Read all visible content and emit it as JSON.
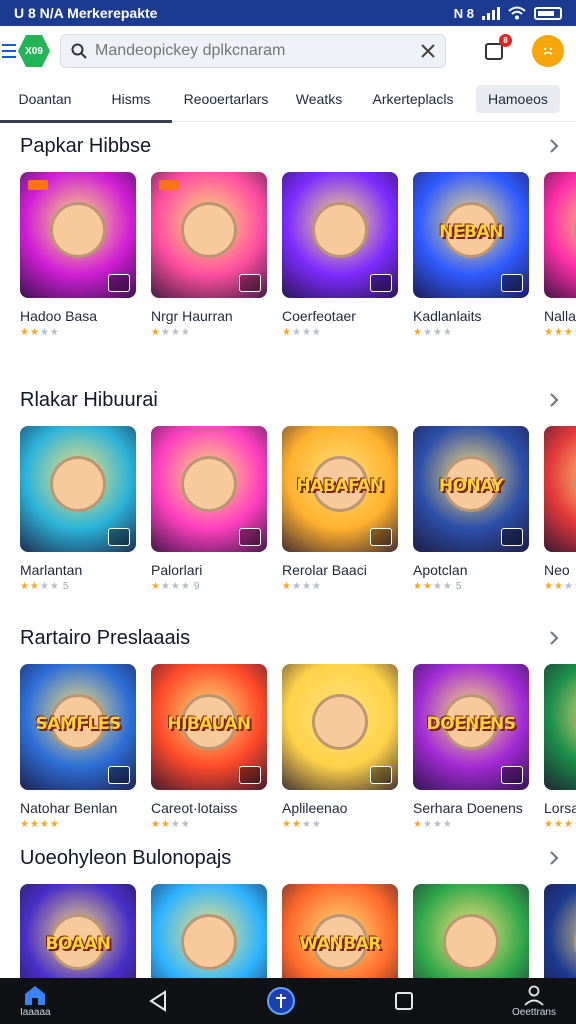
{
  "status_bar": {
    "left_text": "U 8 N/A Merkerepakte",
    "right_text": "N 8"
  },
  "search": {
    "placeholder": "Mandeopickey dplkcnaram"
  },
  "top_bar": {
    "logo_text": "X09",
    "notification_count": "8"
  },
  "tabs": [
    "Doantan",
    "Hisms",
    "Reooertarlars",
    "Weatks",
    "Arkerteplacls",
    "Hamoeos"
  ],
  "sections": [
    {
      "title": "Papkar Hibbse",
      "items": [
        {
          "name": "Hadoo Basa",
          "stars": 2,
          "count": ""
        },
        {
          "name": "Nrgr Haurran",
          "stars": 1,
          "count": ""
        },
        {
          "name": "Coerfeotaer",
          "stars": 1,
          "count": ""
        },
        {
          "name": "Kadlanlaits",
          "stars": 1,
          "count": ""
        },
        {
          "name": "Nalla",
          "stars": 3,
          "count": ""
        }
      ]
    },
    {
      "title": "Rlakar Hibuurai",
      "items": [
        {
          "name": "Marlantan",
          "stars": 2,
          "count": "5"
        },
        {
          "name": "Palorlari",
          "stars": 1,
          "count": "9"
        },
        {
          "name": "Rerolar Baaci",
          "stars": 1,
          "count": ""
        },
        {
          "name": "Apotclan",
          "stars": 2,
          "count": "5"
        },
        {
          "name": "Neo",
          "stars": 2,
          "count": ""
        }
      ]
    },
    {
      "title": "Rartairo Preslaaais",
      "items": [
        {
          "name": "Natohar Benlan",
          "stars": 4,
          "count": ""
        },
        {
          "name": "Careot·lotaiss",
          "stars": 2,
          "count": ""
        },
        {
          "name": "Aplileenao",
          "stars": 2,
          "count": ""
        },
        {
          "name": "Serhara Doenens",
          "stars": 1,
          "count": ""
        },
        {
          "name": "Lorsa",
          "stars": 3,
          "count": ""
        }
      ]
    },
    {
      "title": "Uoeohyleon Bulonopajs",
      "items": [
        {
          "name": "",
          "stars": 0,
          "count": ""
        },
        {
          "name": "",
          "stars": 0,
          "count": ""
        },
        {
          "name": "",
          "stars": 0,
          "count": ""
        },
        {
          "name": "",
          "stars": 0,
          "count": ""
        },
        {
          "name": "",
          "stars": 0,
          "count": ""
        }
      ]
    }
  ],
  "art_titles": {
    "s0_3": "NEBAN",
    "s1_2": "HABAFAN",
    "s1_3": "HONAY",
    "s2_0": "SAMFLES",
    "s2_1": "HIBAUAN",
    "s2_3": "DOENENS",
    "s3_0": "BOAAN",
    "s3_2": "WANBAR"
  },
  "bottom_nav": {
    "home_label": "Iaaaaa",
    "profile_label": "Oeettrans"
  },
  "colors": {
    "accent": "#1c3a8f",
    "gradients": [
      [
        "#d01fd6",
        "#ff4fa0",
        "#7d2cff",
        "#2f5bff",
        "#ff2fa8"
      ],
      [
        "#2bb3d9",
        "#ff3fc0",
        "#ffb12e",
        "#2d4fa8",
        "#e33a3a"
      ],
      [
        "#2d6fd8",
        "#ff4a2a",
        "#ffd24a",
        "#a22bd6",
        "#1c8f4a"
      ],
      [
        "#4a2fc8",
        "#2db4ff",
        "#ff6a2a",
        "#2fa84a",
        "#1c3a8f"
      ]
    ]
  }
}
